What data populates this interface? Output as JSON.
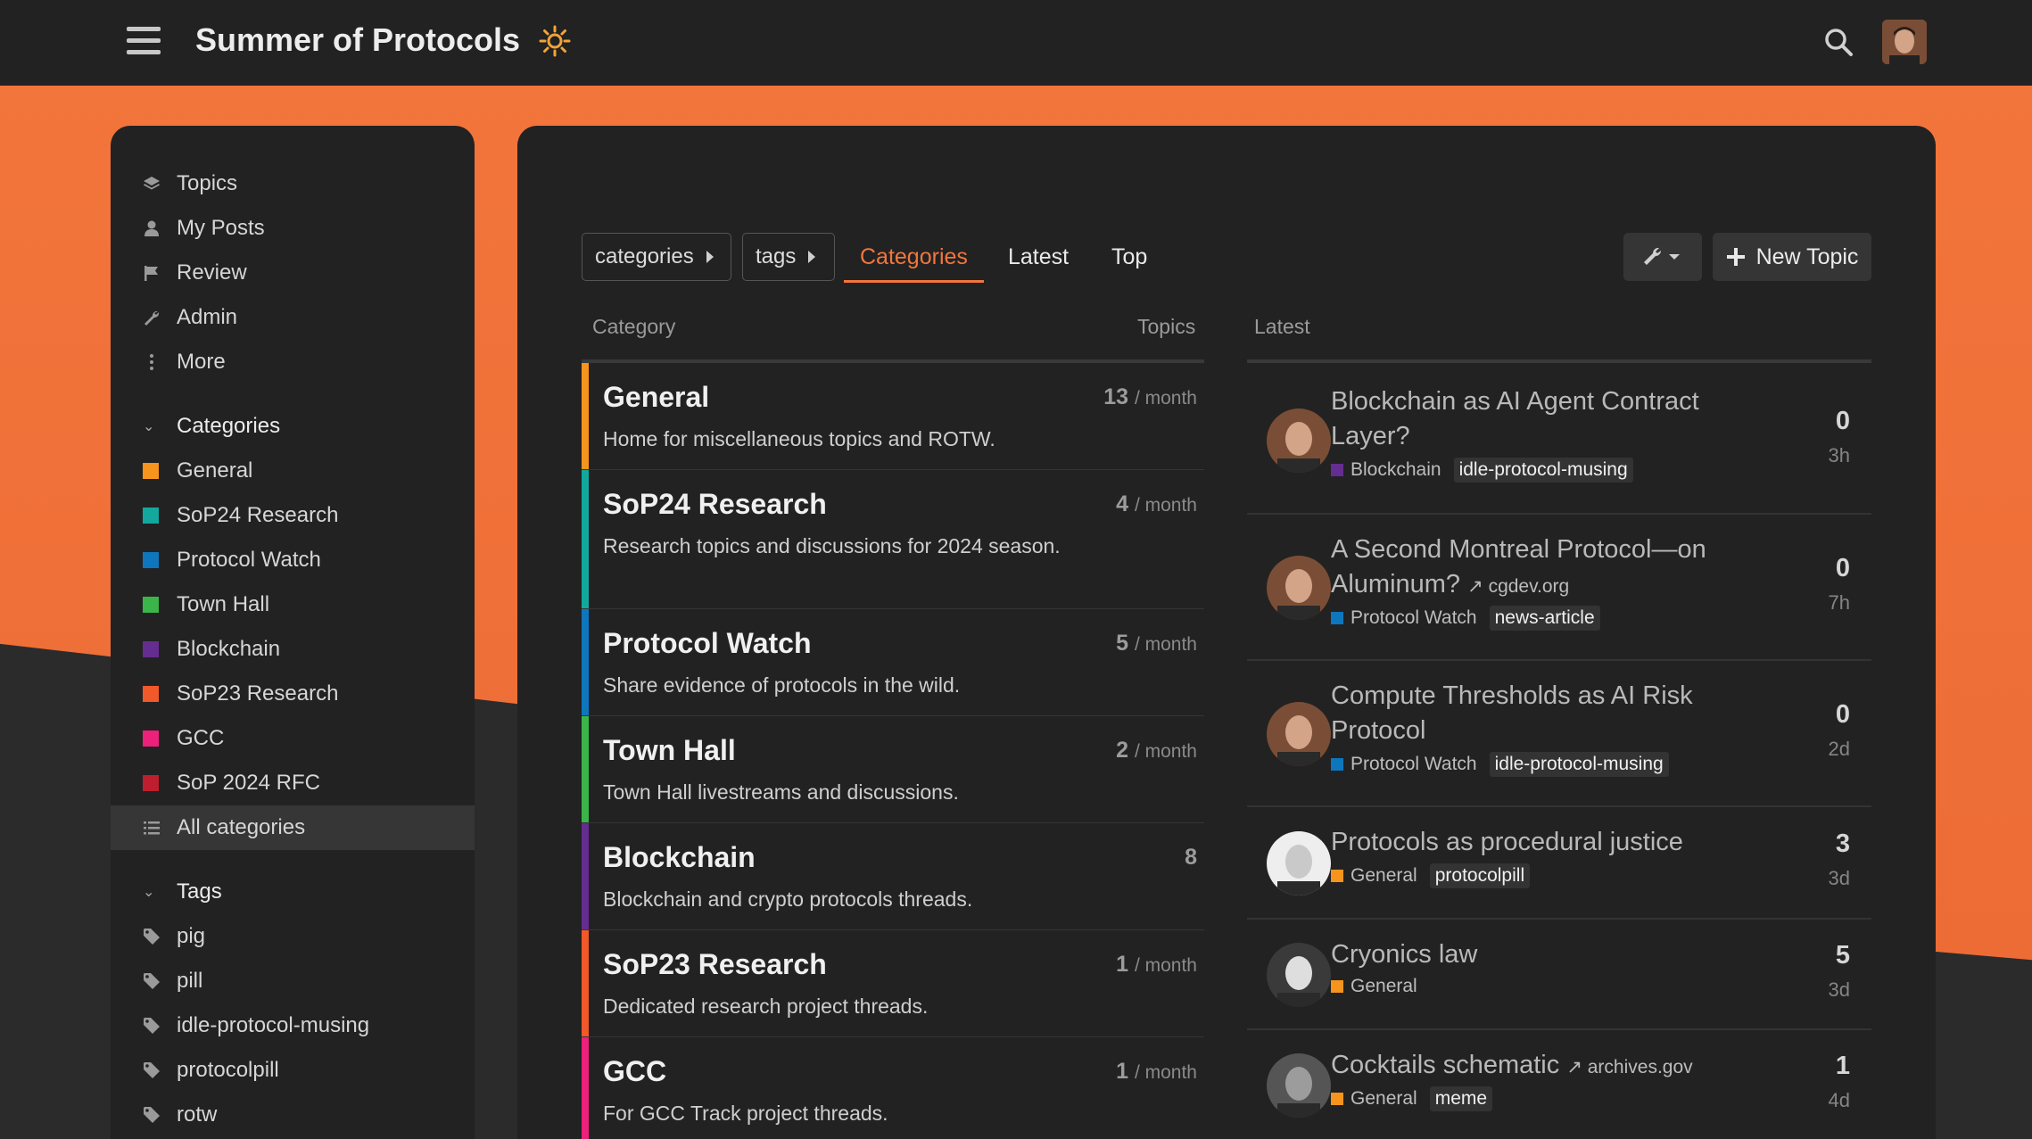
{
  "header": {
    "title": "Summer of Protocols",
    "logo_icon": "sun-icon",
    "accent": "#f2763d"
  },
  "sidebar": {
    "nav": [
      {
        "label": "Topics",
        "icon": "layers-icon"
      },
      {
        "label": "My Posts",
        "icon": "user-icon"
      },
      {
        "label": "Review",
        "icon": "flag-icon"
      },
      {
        "label": "Admin",
        "icon": "wrench-icon"
      },
      {
        "label": "More",
        "icon": "vertical-ellipsis-icon"
      }
    ],
    "categories_heading": "Categories",
    "categories": [
      {
        "label": "General",
        "color": "#f7941d"
      },
      {
        "label": "SoP24 Research",
        "color": "#12a89d"
      },
      {
        "label": "Protocol Watch",
        "color": "#0e76bd"
      },
      {
        "label": "Town Hall",
        "color": "#3ab54a"
      },
      {
        "label": "Blockchain",
        "color": "#652d90"
      },
      {
        "label": "SoP23 Research",
        "color": "#f1592a"
      },
      {
        "label": "GCC",
        "color": "#ed207b"
      },
      {
        "label": "SoP 2024 RFC",
        "color": "#bf1e2e"
      }
    ],
    "all_categories": "All categories",
    "tags_heading": "Tags",
    "tags": [
      "pig",
      "pill",
      "idle-protocol-musing",
      "protocolpill",
      "rotw"
    ]
  },
  "navbar": {
    "categories_drop": "categories",
    "tags_drop": "tags",
    "tabs": [
      "Categories",
      "Latest",
      "Top"
    ],
    "new_topic": "New Topic"
  },
  "table": {
    "col_category": "Category",
    "col_topics": "Topics",
    "col_latest": "Latest",
    "categories": [
      {
        "name": "General",
        "desc": "Home for miscellaneous topics and ROTW.",
        "count": "13",
        "period": "/ month",
        "color": "#f7941d"
      },
      {
        "name": "SoP24 Research",
        "desc": "Research topics and discussions for 2024 season.",
        "count": "4",
        "period": "/ month",
        "color": "#12a89d"
      },
      {
        "name": "Protocol Watch",
        "desc": "Share evidence of protocols in the wild.",
        "count": "5",
        "period": "/ month",
        "color": "#0e76bd"
      },
      {
        "name": "Town Hall",
        "desc": "Town Hall livestreams and discussions.",
        "count": "2",
        "period": "/ month",
        "color": "#3ab54a"
      },
      {
        "name": "Blockchain",
        "desc": "Blockchain and crypto protocols threads.",
        "count": "8",
        "period": "",
        "color": "#652d90"
      },
      {
        "name": "SoP23 Research",
        "desc": "Dedicated research project threads.",
        "count": "1",
        "period": "/ month",
        "color": "#f1592a"
      },
      {
        "name": "GCC",
        "desc": "For GCC Track project threads.",
        "count": "1",
        "period": "/ month",
        "color": "#ed207b"
      }
    ],
    "latest": [
      {
        "title": "Blockchain as AI Agent Contract Layer?",
        "ext": "",
        "category": "Blockchain",
        "cat_color": "#652d90",
        "tag": "idle-protocol-musing",
        "replies": "0",
        "age": "3h"
      },
      {
        "title": "A Second Montreal Protocol—on Aluminum?",
        "ext": "cgdev.org",
        "category": "Protocol Watch",
        "cat_color": "#0e76bd",
        "tag": "news-article",
        "replies": "0",
        "age": "7h"
      },
      {
        "title": "Compute Thresholds as AI Risk Protocol",
        "ext": "",
        "category": "Protocol Watch",
        "cat_color": "#0e76bd",
        "tag": "idle-protocol-musing",
        "replies": "0",
        "age": "2d"
      },
      {
        "title": "Protocols as procedural justice",
        "ext": "",
        "category": "General",
        "cat_color": "#f7941d",
        "tag": "protocolpill",
        "replies": "3",
        "age": "3d"
      },
      {
        "title": "Cryonics law",
        "ext": "",
        "category": "General",
        "cat_color": "#f7941d",
        "tag": "",
        "replies": "5",
        "age": "3d"
      },
      {
        "title": "Cocktails schematic",
        "ext": "archives.gov",
        "category": "General",
        "cat_color": "#f7941d",
        "tag": "meme",
        "replies": "1",
        "age": "4d"
      }
    ]
  }
}
